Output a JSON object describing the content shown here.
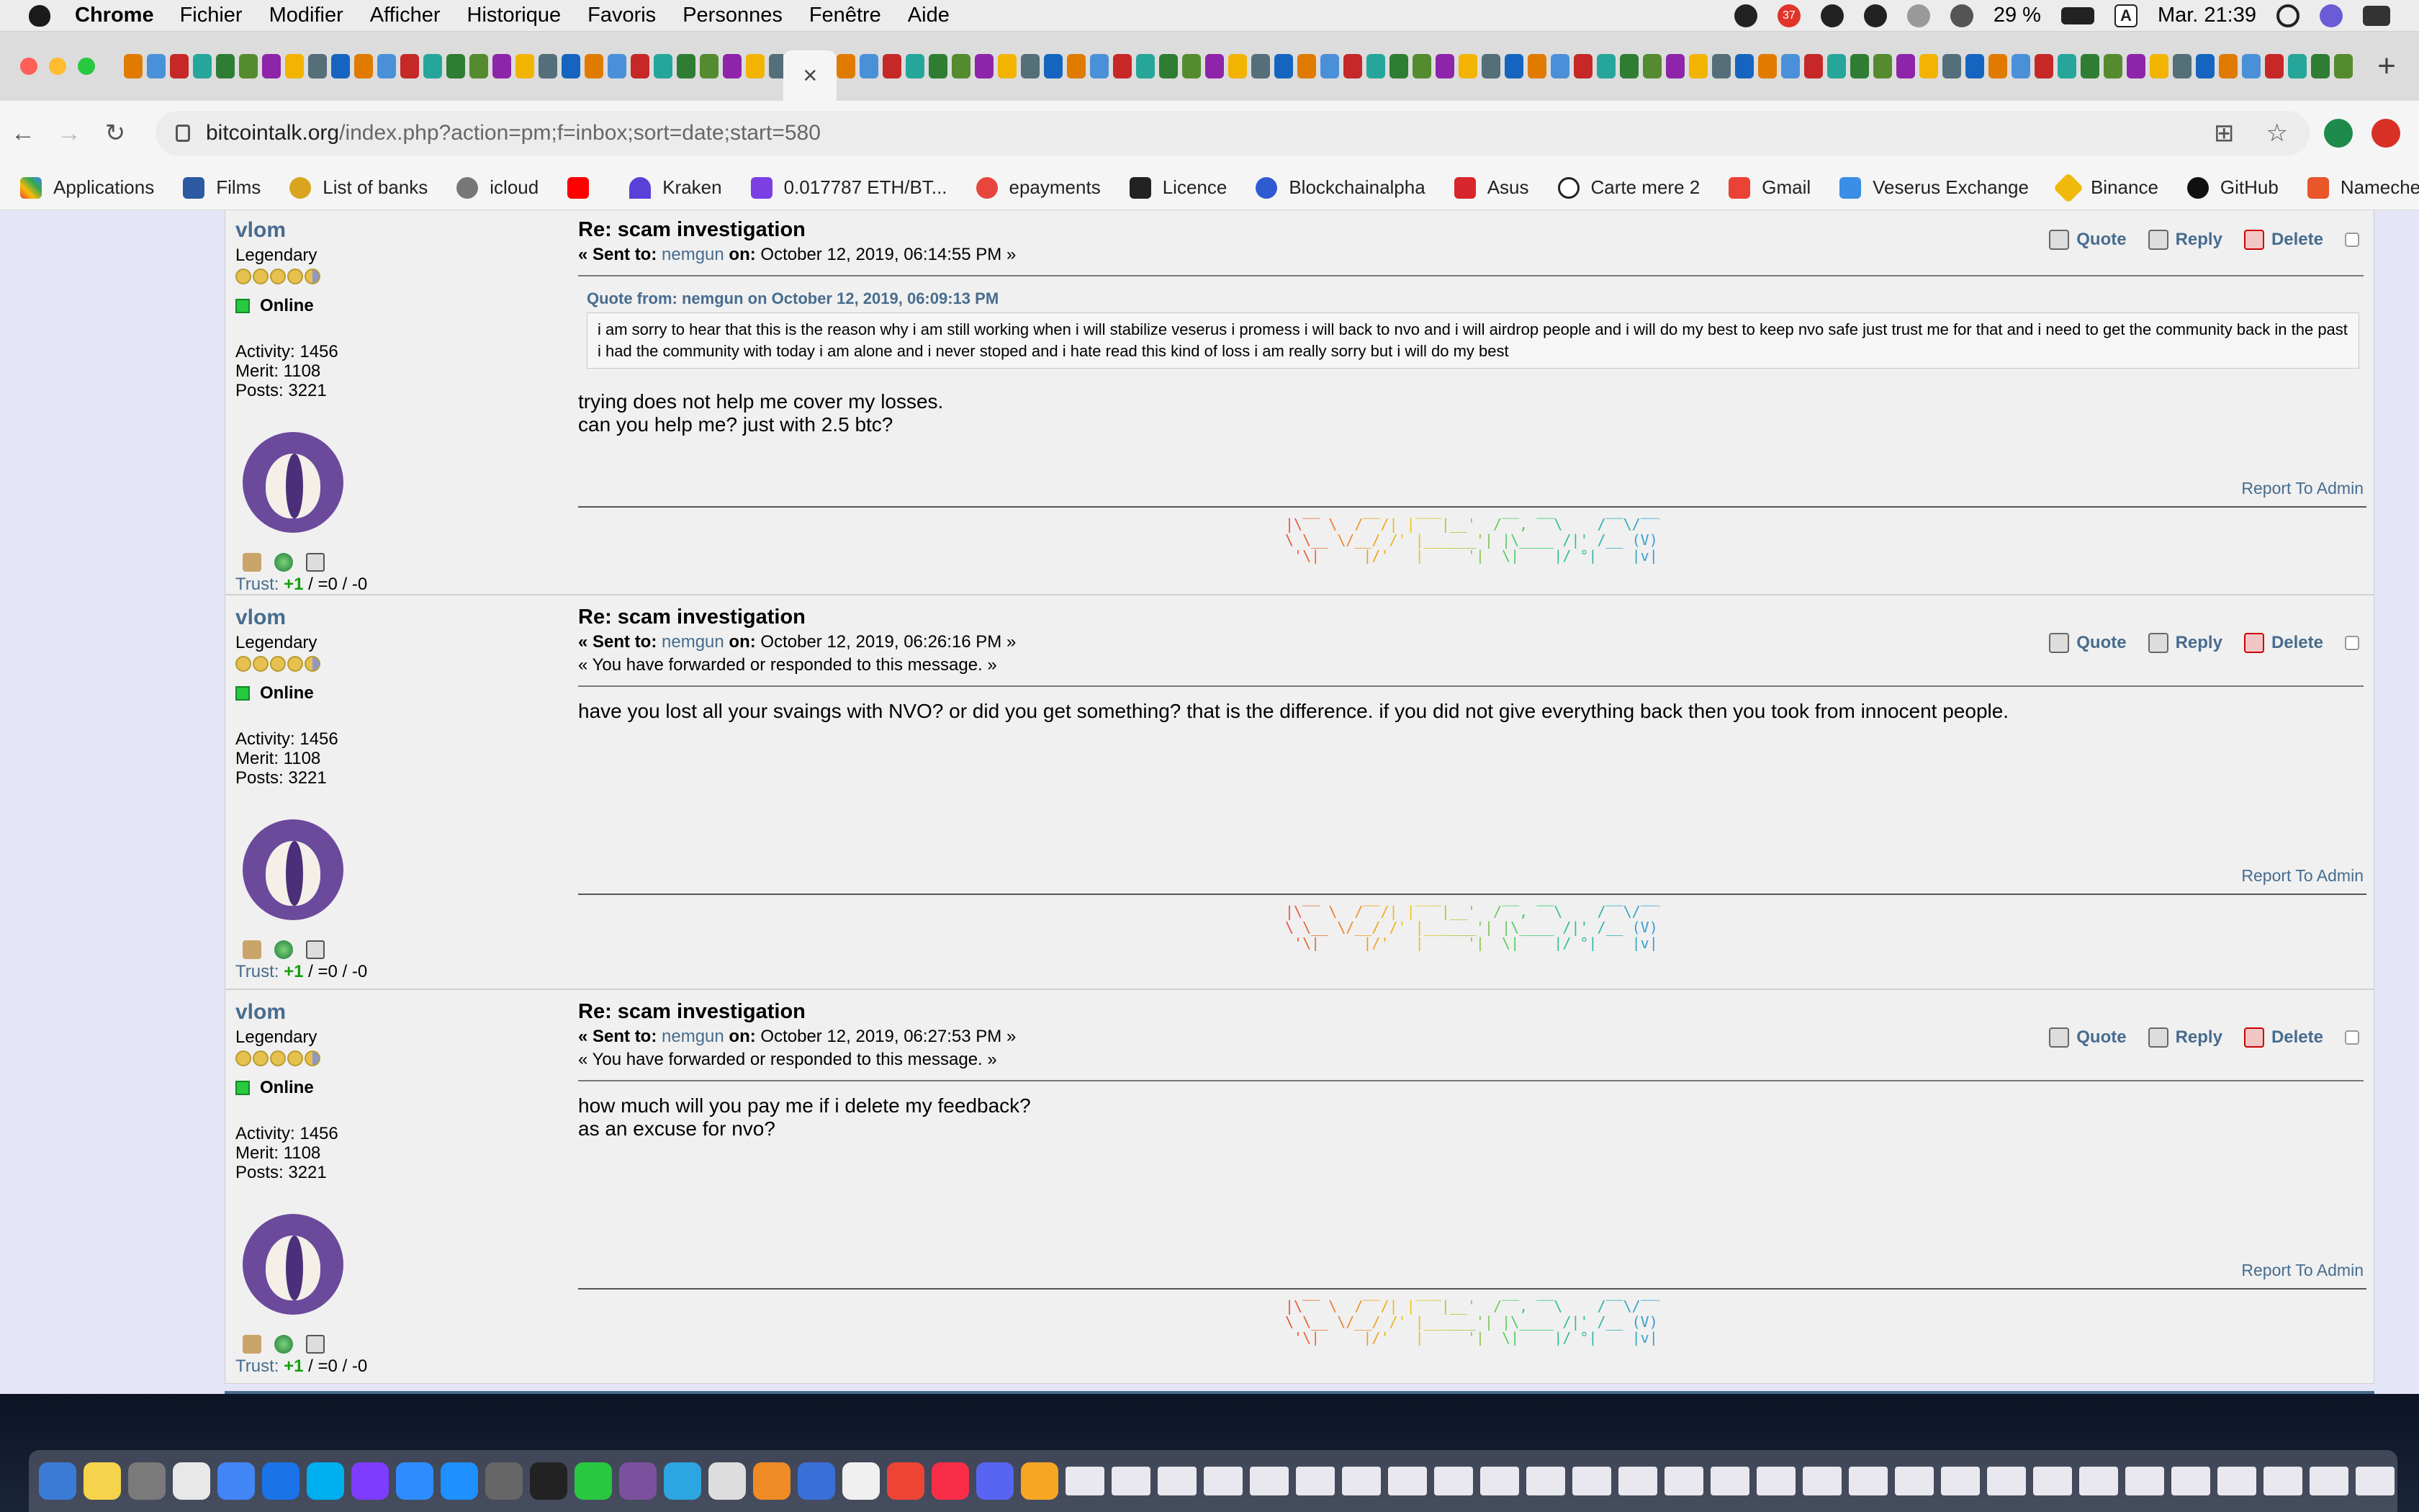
{
  "menubar": {
    "app": "Chrome",
    "items": [
      "Fichier",
      "Modifier",
      "Afficher",
      "Historique",
      "Favoris",
      "Personnes",
      "Fenêtre",
      "Aide"
    ],
    "battery": "29 %",
    "input_source": "A",
    "clock": "Mar. 21:39",
    "badge": "37"
  },
  "browser": {
    "active_tab_close": "×",
    "new_tab": "+",
    "url_host": "bitcointalk.org",
    "url_path": "/index.php?action=pm;f=inbox;sort=date;start=580"
  },
  "bookmarks": [
    "Applications",
    "Films",
    "List of banks",
    "icloud",
    "Kraken",
    "0.017787 ETH/BT...",
    "epayments",
    "Licence",
    "Blockchainalpha",
    "Asus",
    "Carte mere 2",
    "Gmail",
    "Veserus Exchange",
    "Binance",
    "GitHub",
    "Namecheap"
  ],
  "bookmarks_more": "»",
  "labels": {
    "quote": "Quote",
    "reply": "Reply",
    "delete": "Delete",
    "report": "Report To Admin",
    "sent_to_prefix": "« Sent to:",
    "on": "on:",
    "online": "Online",
    "trust_label": "Trust:",
    "trust_pos": "+1",
    "trust_rest": "/ =0 / -0"
  },
  "poster": {
    "name": "vlom",
    "rank": "Legendary",
    "activity": "Activity: 1456",
    "merit": "Merit: 1108",
    "posts": "Posts: 3221"
  },
  "signature_ascii": "|\\‾‾ \\  /‾‾/| |‾‾‾|__'  /‾‾, ‾‾\\    /‾‾\\/‾‾\\\n\\ \\__ \\/__/ /' |______'| |\\____ /|' /__ (V) __\\'\n '\\|____ |/'   |_____'|  \\|___ |/ °|___ |v|___|",
  "messages": [
    {
      "subject": "Re: scam investigation",
      "sent_to": "nemgun",
      "date": "October 12, 2019, 06:14:55 PM »",
      "quote_header": "Quote from: nemgun on October 12, 2019, 06:09:13 PM",
      "quote": "i am sorry to hear that this is the reason why i am still working when i will stabilize veserus i promess i will back to nvo and i will airdrop people and i will do my best to keep nvo safe just trust me for that and i need to get the community back in the past i had the community with today i am alone and i never stoped and i hate read this kind of loss i am really sorry but i will do my best",
      "body": "trying does not help me cover my losses.\ncan you help me? just with 2.5 btc?"
    },
    {
      "subject": "Re: scam investigation",
      "sent_to": "nemgun",
      "date": "October 12, 2019, 06:26:16 PM »",
      "forwarded": "« You have forwarded or responded to this message. »",
      "body": "have you lost all your svaings with NVO? or did you get something? that is the difference. if you did not give everything back then you took from innocent people."
    },
    {
      "subject": "Re: scam investigation",
      "sent_to": "nemgun",
      "date": "October 12, 2019, 06:27:53 PM »",
      "forwarded": "« You have forwarded or responded to this message. »",
      "body": "how much will you pay me if i delete my feedback?\nas an excuse for nvo?"
    }
  ],
  "colors": {
    "link": "#476c8e",
    "trust_positive": "#14a010",
    "online": "#27c93f",
    "page_bg": "#e5e5f8"
  }
}
